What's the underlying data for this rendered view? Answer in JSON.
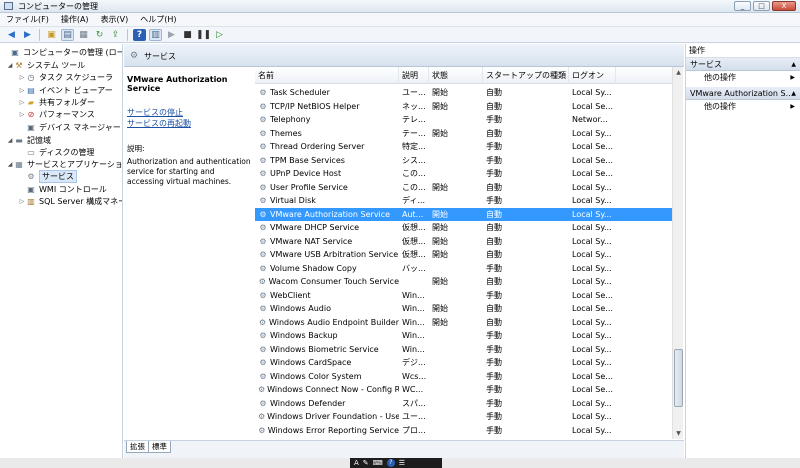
{
  "window": {
    "title": "コンピューターの管理",
    "buttons": {
      "minimize": "_",
      "maximize": "□",
      "close": "X"
    }
  },
  "menu": [
    "ファイル(F)",
    "操作(A)",
    "表示(V)",
    "ヘルプ(H)"
  ],
  "toolbar": [
    "back-icon",
    "forward-icon",
    "up-icon",
    "show-tree-icon",
    "properties-icon",
    "refresh-icon",
    "export-icon",
    "help-icon",
    "view-icon",
    "play-icon",
    "stop-icon",
    "pause-icon",
    "restart-icon"
  ],
  "tree": [
    {
      "label": "コンピューターの管理 (ローカ",
      "icon": "computer-icon",
      "exp": ""
    },
    {
      "label": "システム ツール",
      "icon": "tools-icon",
      "exp": "◢"
    },
    {
      "label": "タスク スケジューラ",
      "icon": "clock-icon",
      "exp": "▷"
    },
    {
      "label": "イベント ビューアー",
      "icon": "event-icon",
      "exp": "▷"
    },
    {
      "label": "共有フォルダー",
      "icon": "folder-icon",
      "exp": "▷"
    },
    {
      "label": "パフォーマンス",
      "icon": "performance-icon",
      "exp": "▷"
    },
    {
      "label": "デバイス マネージャー",
      "icon": "device-icon",
      "exp": ""
    },
    {
      "label": "記憶域",
      "icon": "storage-icon",
      "exp": "◢"
    },
    {
      "label": "ディスクの管理",
      "icon": "disk-icon",
      "exp": ""
    },
    {
      "label": "サービスとアプリケーション",
      "icon": "apps-icon",
      "exp": "◢"
    },
    {
      "label": "サービス",
      "icon": "gear-icon",
      "exp": ""
    },
    {
      "label": "WMI コントロール",
      "icon": "wmi-icon",
      "exp": ""
    },
    {
      "label": "SQL Server 構成マネー",
      "icon": "sql-icon",
      "exp": "▷"
    }
  ],
  "pane_header": "サービス",
  "description": {
    "service_name": "VMware Authorization Service",
    "stop_link": "サービスの停止",
    "restart_link": "サービスの再起動",
    "label": "説明:",
    "text": "Authorization and authentication service for starting and accessing virtual machines."
  },
  "columns": [
    "名前",
    "説明",
    "状態",
    "スタートアップの種類",
    "ログオン"
  ],
  "services": [
    [
      "Task Scheduler",
      "ユー...",
      "開始",
      "自動",
      "Local Sy..."
    ],
    [
      "TCP/IP NetBIOS Helper",
      "ネッ...",
      "開始",
      "自動",
      "Local Se..."
    ],
    [
      "Telephony",
      "テレ...",
      "",
      "手動",
      "Networ..."
    ],
    [
      "Themes",
      "テー...",
      "開始",
      "自動",
      "Local Sy..."
    ],
    [
      "Thread Ordering Server",
      "特定...",
      "",
      "手動",
      "Local Se..."
    ],
    [
      "TPM Base Services",
      "シス...",
      "",
      "手動",
      "Local Se..."
    ],
    [
      "UPnP Device Host",
      "この...",
      "",
      "手動",
      "Local Se..."
    ],
    [
      "User Profile Service",
      "この...",
      "開始",
      "自動",
      "Local Sy..."
    ],
    [
      "Virtual Disk",
      "ディ...",
      "",
      "手動",
      "Local Sy..."
    ],
    [
      "VMware Authorization Service",
      "Aut...",
      "開始",
      "自動",
      "Local Sy..."
    ],
    [
      "VMware DHCP Service",
      "仮想...",
      "開始",
      "自動",
      "Local Sy..."
    ],
    [
      "VMware NAT Service",
      "仮想...",
      "開始",
      "自動",
      "Local Sy..."
    ],
    [
      "VMware USB Arbitration Service",
      "仮想...",
      "開始",
      "自動",
      "Local Sy..."
    ],
    [
      "Volume Shadow Copy",
      "バッ...",
      "",
      "手動",
      "Local Sy..."
    ],
    [
      "Wacom Consumer Touch Service",
      "",
      "開始",
      "自動",
      "Local Sy..."
    ],
    [
      "WebClient",
      "Win...",
      "",
      "手動",
      "Local Se..."
    ],
    [
      "Windows Audio",
      "Win...",
      "開始",
      "自動",
      "Local Se..."
    ],
    [
      "Windows Audio Endpoint Builder",
      "Win...",
      "開始",
      "自動",
      "Local Sy..."
    ],
    [
      "Windows Backup",
      "Win...",
      "",
      "手動",
      "Local Sy..."
    ],
    [
      "Windows Biometric Service",
      "Win...",
      "",
      "手動",
      "Local Sy..."
    ],
    [
      "Windows CardSpace",
      "デジ...",
      "",
      "手動",
      "Local Sy..."
    ],
    [
      "Windows Color System",
      "Wcs...",
      "",
      "手動",
      "Local Se..."
    ],
    [
      "Windows Connect Now - Config R...",
      "WC...",
      "",
      "手動",
      "Local Se..."
    ],
    [
      "Windows Defender",
      "スパ...",
      "",
      "手動",
      "Local Sy..."
    ],
    [
      "Windows Driver Foundation - User...",
      "ユー...",
      "",
      "手動",
      "Local Sy..."
    ],
    [
      "Windows Error Reporting Service",
      "プロ...",
      "",
      "手動",
      "Local Sy..."
    ]
  ],
  "selected_service": "VMware Authorization Service",
  "tabs": [
    "拡張",
    "標準"
  ],
  "actions": {
    "title": "操作",
    "sections": [
      {
        "header": "サービス",
        "items": [
          "他の操作"
        ]
      },
      {
        "header": "VMware Authorization S...",
        "items": [
          "他の操作"
        ]
      }
    ]
  },
  "colors": {
    "selection": "#3399ff",
    "link": "#1a4fa3"
  }
}
